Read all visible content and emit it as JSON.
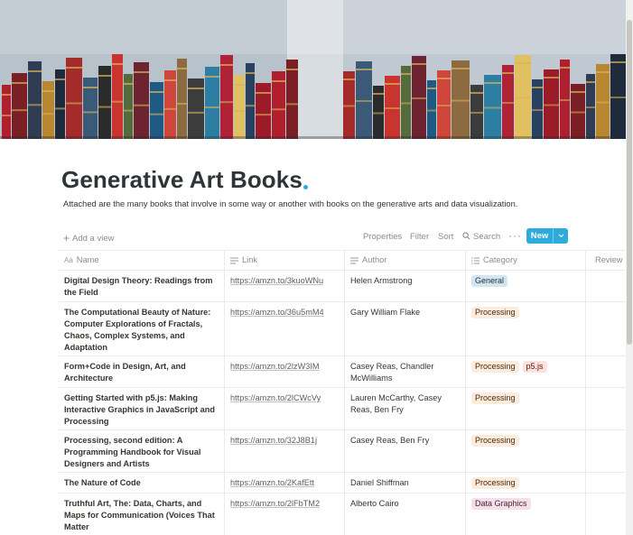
{
  "page": {
    "title": "Generative Art Books",
    "description": "Attached are the many books that involve in some way or another with books on the generative arts and data visualization."
  },
  "toolbar": {
    "add_view": "Add a view",
    "properties": "Properties",
    "filter": "Filter",
    "sort": "Sort",
    "search": "Search",
    "more": "···",
    "new": "New"
  },
  "columns": {
    "name": "Name",
    "link": "Link",
    "author": "Author",
    "category": "Category",
    "review": "Review"
  },
  "rows": [
    {
      "name": "Digital Design Theory: Readings from the Field",
      "link": "https://amzn.to/3kuoWNu",
      "author": "Helen Armstrong",
      "tags": [
        "General"
      ]
    },
    {
      "name": "The Computational Beauty of Nature: Computer Explorations of Fractals, Chaos, Complex Systems, and Adaptation",
      "link": "https://amzn.to/36u5mM4",
      "author": "Gary William Flake",
      "tags": [
        "Processing"
      ]
    },
    {
      "name": "Form+Code in Design, Art, and Architecture",
      "link": "https://amzn.to/2lzW3IM",
      "author": "Casey Reas, Chandler McWilliams",
      "tags": [
        "Processing",
        "p5.js"
      ]
    },
    {
      "name": "Getting Started with p5.js: Making Interactive Graphics in JavaScript and Processing",
      "link": "https://amzn.to/2lCWcVy",
      "author": "Lauren McCarthy, Casey Reas, Ben Fry",
      "tags": [
        "Processing"
      ]
    },
    {
      "name": "Processing, second edition: A Programming Handbook for Visual Designers and Artists",
      "link": "https://amzn.to/32J8B1j",
      "author": "Casey Reas, Ben Fry",
      "tags": [
        "Processing"
      ]
    },
    {
      "name": "The Nature of Code",
      "link": "https://amzn.to/2KafEtt",
      "author": "Daniel Shiffman",
      "tags": [
        "Processing"
      ]
    },
    {
      "name": "Truthful Art, The: Data, Charts, and Maps for Communication (Voices That Matter",
      "link": "https://amzn.to/2lFbTM2",
      "author": "Alberto Cairo",
      "tags": [
        "Data Graphics"
      ]
    }
  ],
  "tag_colors": {
    "General": "#d3e5ef",
    "Processing": "#fbecdd",
    "p5.js": "#ffe2dd",
    "Data Graphics": "#f5e0e9"
  },
  "accent": "#2eaadc"
}
